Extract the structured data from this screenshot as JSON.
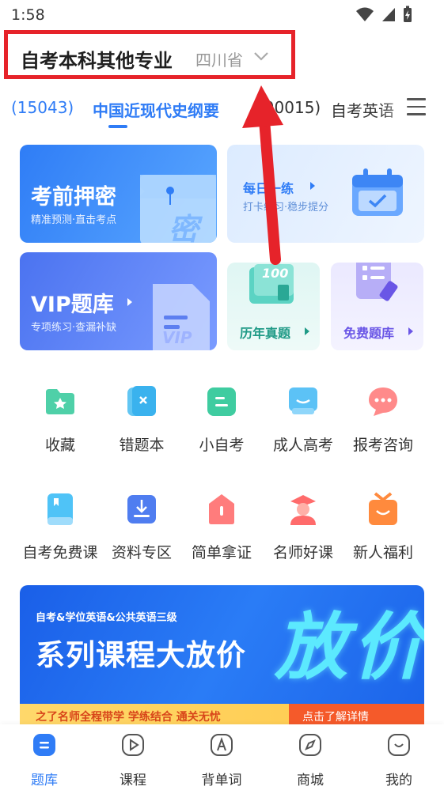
{
  "status_bar": {
    "time": "1:58"
  },
  "header": {
    "title": "自考本科其他专业",
    "province": "四川省"
  },
  "tabs": [
    {
      "code": "(15043)",
      "label": "中国近现代史纲要"
    },
    {
      "code": "(00015)",
      "label": "自考英语"
    }
  ],
  "cards": {
    "exam": {
      "title": "考前押密",
      "subtitle": "精准预测·直击考点",
      "art": "密"
    },
    "daily": {
      "title": "每日一练",
      "subtitle": "打卡练习·稳步提分"
    },
    "vip": {
      "title": "VIP题库",
      "subtitle": "专项练习·查漏补缺",
      "art": "VIP"
    },
    "past": {
      "title": "历年真题",
      "art": "100"
    },
    "free": {
      "title": "免费题库"
    }
  },
  "shortcuts": [
    {
      "label": "收藏",
      "icon": "folder-star-icon"
    },
    {
      "label": "错题本",
      "icon": "wrong-book-icon"
    },
    {
      "label": "小自考",
      "icon": "small-exam-icon"
    },
    {
      "label": "成人高考",
      "icon": "adult-exam-icon"
    },
    {
      "label": "报考咨询",
      "icon": "chat-bubble-icon"
    },
    {
      "label": "自考免费课",
      "icon": "free-course-icon"
    },
    {
      "label": "资料专区",
      "icon": "download-tray-icon"
    },
    {
      "label": "简单拿证",
      "icon": "house-tag-icon"
    },
    {
      "label": "名师好课",
      "icon": "teacher-icon"
    },
    {
      "label": "新人福利",
      "icon": "gift-box-icon"
    }
  ],
  "banner": {
    "subtitle": "自考&学位英语&公共英语三级",
    "title": "系列课程大放价",
    "big_text": "放价",
    "strip_text": "之了名师全程带学 学练结合 通关无忧",
    "button": "点击了解详情"
  },
  "bottom_nav": [
    {
      "label": "题库",
      "icon": "question-bank-icon",
      "active": true
    },
    {
      "label": "课程",
      "icon": "play-course-icon",
      "active": false
    },
    {
      "label": "背单词",
      "icon": "letter-a-icon",
      "active": false
    },
    {
      "label": "商城",
      "icon": "compass-store-icon",
      "active": false
    },
    {
      "label": "我的",
      "icon": "profile-smile-icon",
      "active": false
    }
  ],
  "colors": {
    "accent": "#2f7cf6",
    "annotation": "#e6232a"
  }
}
